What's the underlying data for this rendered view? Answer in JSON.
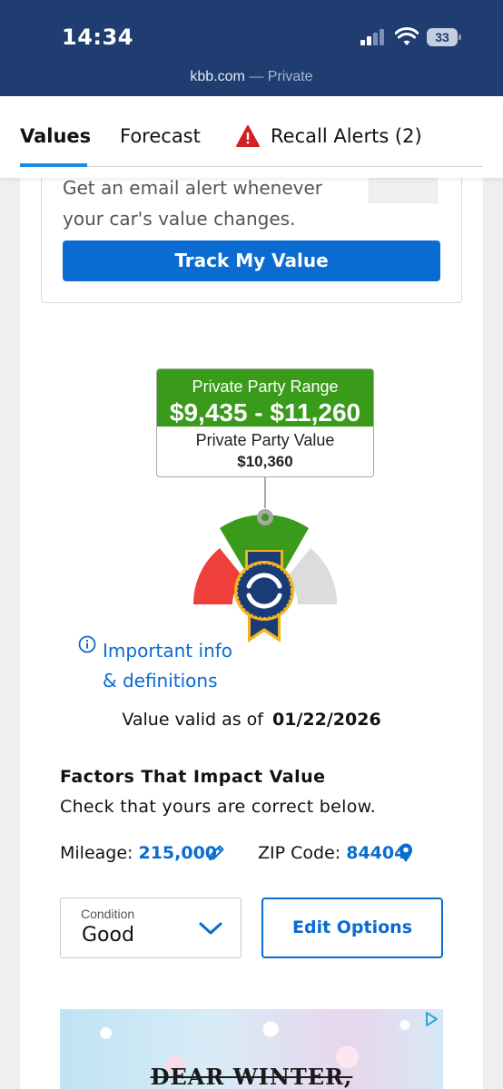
{
  "status_bar": {
    "time": "14:34",
    "battery": "33",
    "url": "kbb.com",
    "mode": "— Private"
  },
  "tabs": [
    {
      "label": "Values",
      "active": true
    },
    {
      "label": "Forecast",
      "active": false
    },
    {
      "label": "Recall Alerts (2)",
      "active": false,
      "icon": "warning-icon"
    }
  ],
  "track": {
    "text": "Get an email alert whenever your car's value changes.",
    "button": "Track My Value"
  },
  "valuation": {
    "range_label": "Private Party Range",
    "range_value": "$9,435 - $11,260",
    "value_label": "Private Party Value",
    "value": "$10,360"
  },
  "info_link": "Important info & definitions",
  "valid": {
    "label": "Value valid as of",
    "date": "01/22/2026"
  },
  "factors": {
    "title": "Factors That Impact Value",
    "subtitle": "Check that yours are correct below.",
    "mileage_label": "Mileage:",
    "mileage_value": "215,000",
    "zip_label": "ZIP Code:",
    "zip_value": "84404"
  },
  "condition": {
    "label": "Condition",
    "value": "Good"
  },
  "edit_button": "Edit Options",
  "ad": {
    "text": "DEAR WINTER,"
  },
  "colors": {
    "header_bg": "#1f3d70",
    "accent_blue": "#0a6bd0",
    "range_green": "#3a9a1a",
    "gauge_red": "#f0403c",
    "gauge_grey": "#dcdcdc",
    "ribbon_navy": "#1b3a78",
    "ribbon_gold": "#f2b41c"
  }
}
